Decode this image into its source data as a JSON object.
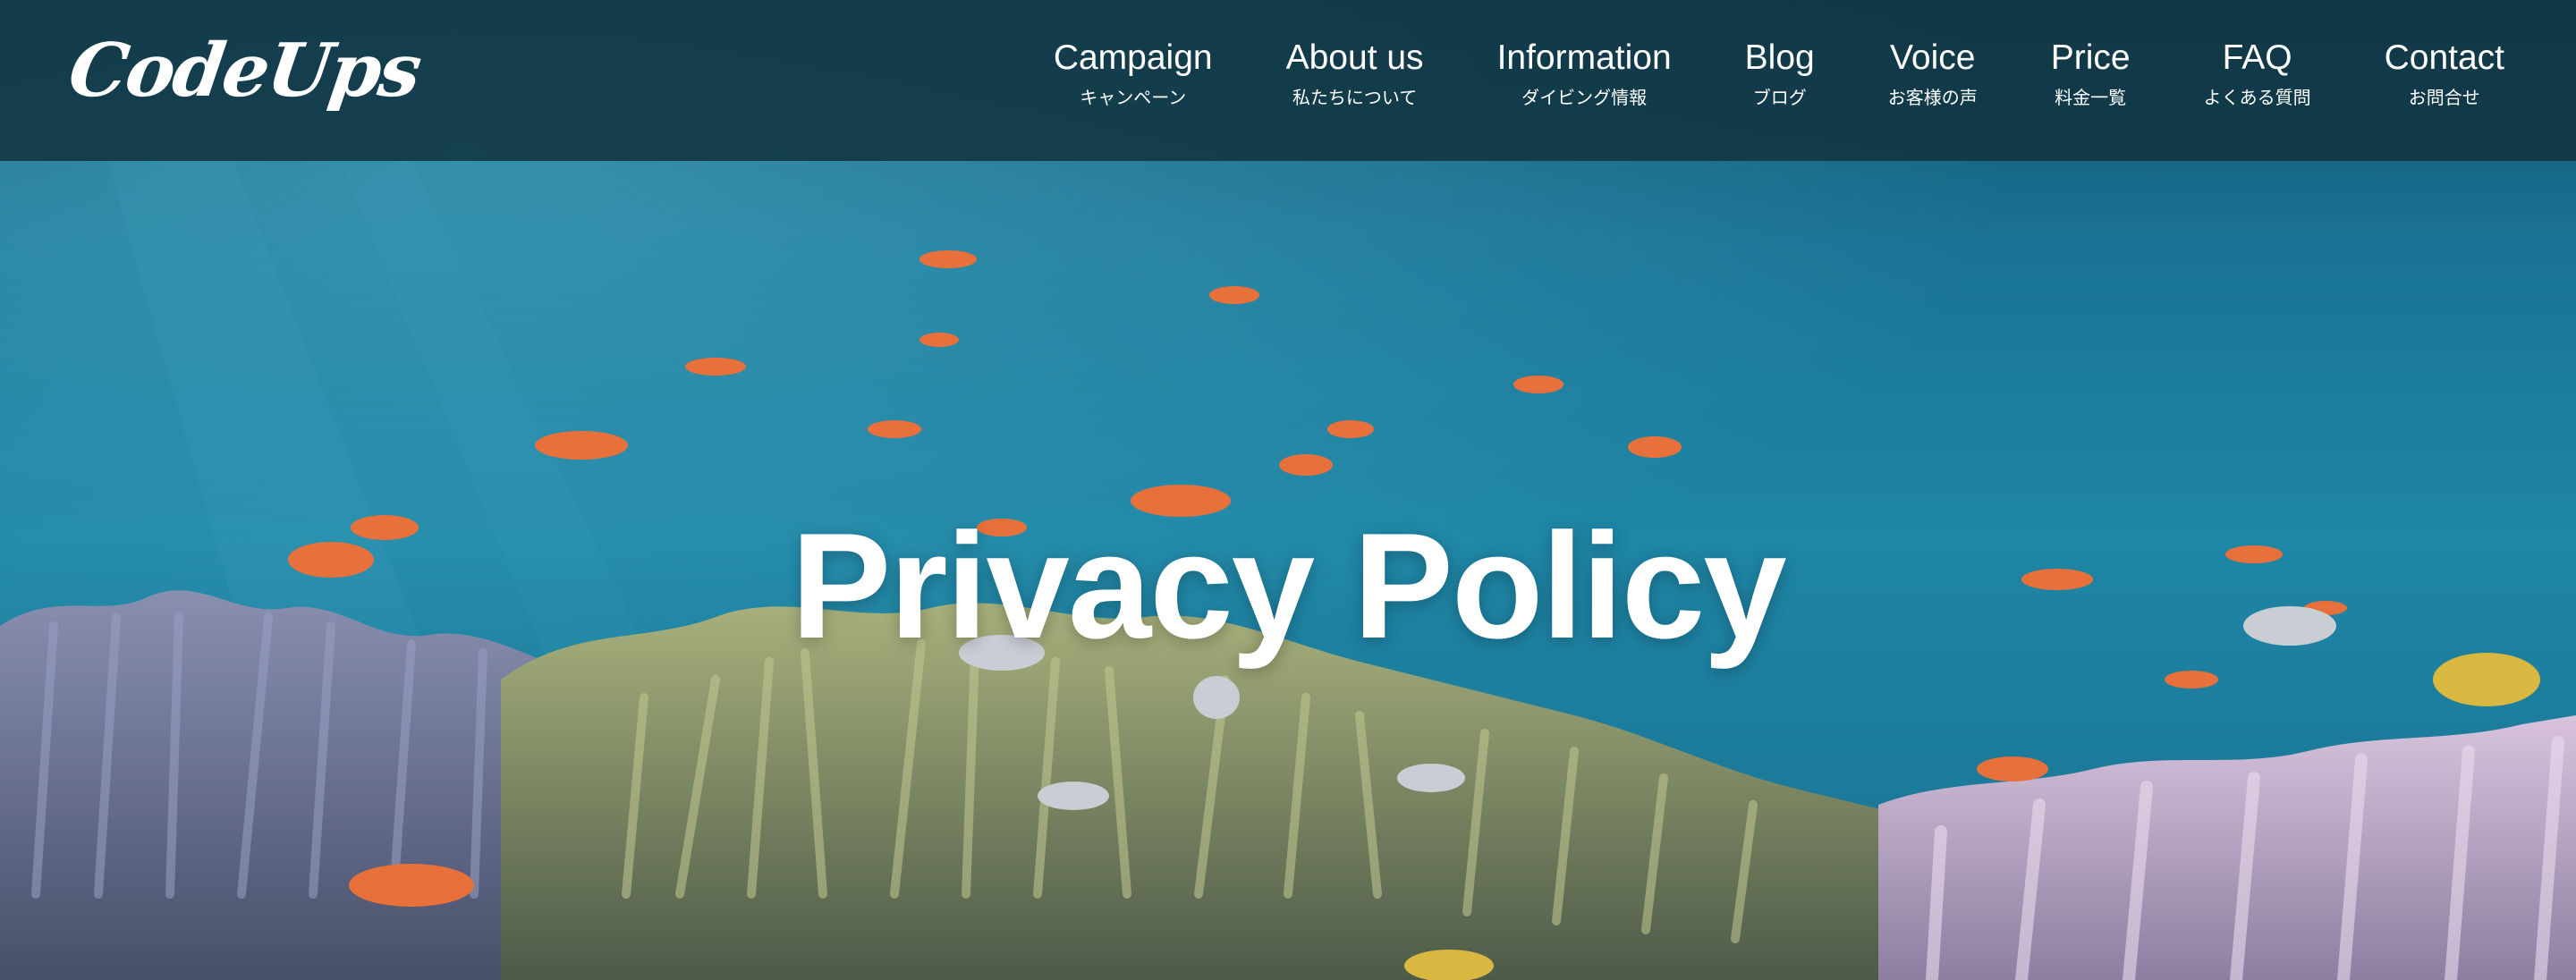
{
  "header": {
    "logo": "CodeUps",
    "nav": [
      {
        "en": "Campaign",
        "ja": "キャンペーン"
      },
      {
        "en": "About us",
        "ja": "私たちについて"
      },
      {
        "en": "Information",
        "ja": "ダイビング情報"
      },
      {
        "en": "Blog",
        "ja": "ブログ"
      },
      {
        "en": "Voice",
        "ja": "お客様の声"
      },
      {
        "en": "Price",
        "ja": "料金一覧"
      },
      {
        "en": "FAQ",
        "ja": "よくある質問"
      },
      {
        "en": "Contact",
        "ja": "お問合せ"
      }
    ]
  },
  "hero": {
    "title": "Privacy Policy"
  },
  "colors": {
    "header_bg": "#113442",
    "water_top": "#1a6d8c",
    "water_mid": "#1f87a8",
    "coral": "#8a9a68",
    "fish_orange": "#e8703a"
  }
}
